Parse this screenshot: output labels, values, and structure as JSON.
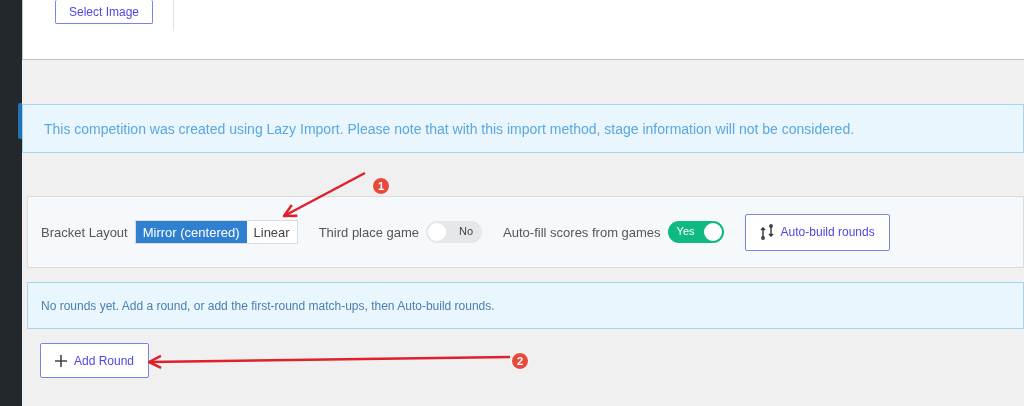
{
  "image_card": {
    "button": "Select Image"
  },
  "notice": "This competition was created using Lazy Import. Please note that with this import method, stage information will not be considered.",
  "settings": {
    "bracket_layout": {
      "label": "Bracket Layout",
      "options": [
        {
          "label": "Mirror (centered)",
          "selected": true
        },
        {
          "label": "Linear",
          "selected": false
        }
      ]
    },
    "toggles": [
      {
        "label": "Third place game",
        "on": false,
        "state_text": "No"
      },
      {
        "label": "Auto-fill scores from games",
        "on": true,
        "state_text": "Yes"
      }
    ],
    "auto_build_button": "Auto-build rounds"
  },
  "empty_message": "No rounds yet. Add a round, or add the first-round match-ups, then Auto-build rounds.",
  "add_round_button": "Add Round",
  "annotations": [
    {
      "number": "1"
    },
    {
      "number": "2"
    }
  ]
}
